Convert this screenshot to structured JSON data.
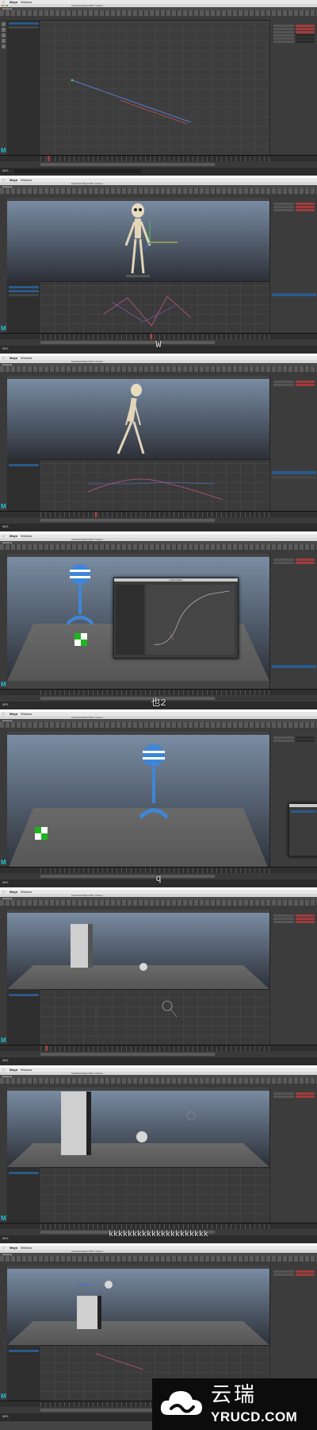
{
  "app": {
    "apple_glyph": "",
    "app_name": "Maya",
    "window_menu": "Window",
    "title_text": "Autodesk Maya 2016: /Users/...",
    "mode": "Modeling",
    "mel_label": "MEL"
  },
  "captions": {
    "frame2": "W",
    "frame4": "也2",
    "frame5": "q",
    "frame7": "kkkkkkkkkkkkkkkkkkkkk"
  },
  "floating_window": {
    "title": "Graph Editor"
  },
  "watermark": {
    "chinese": "云瑞",
    "url": "YRUCD.COM"
  },
  "colors": {
    "maya_teal": "#22c3d8",
    "channel_red": "#a23b3b",
    "selection_blue": "#2a5a8a",
    "viewport_top": "#7c8fa6",
    "viewport_bottom": "#2c3038"
  },
  "icons": [
    "apple-icon",
    "maya-logo-icon",
    "cloud-logo-icon"
  ]
}
